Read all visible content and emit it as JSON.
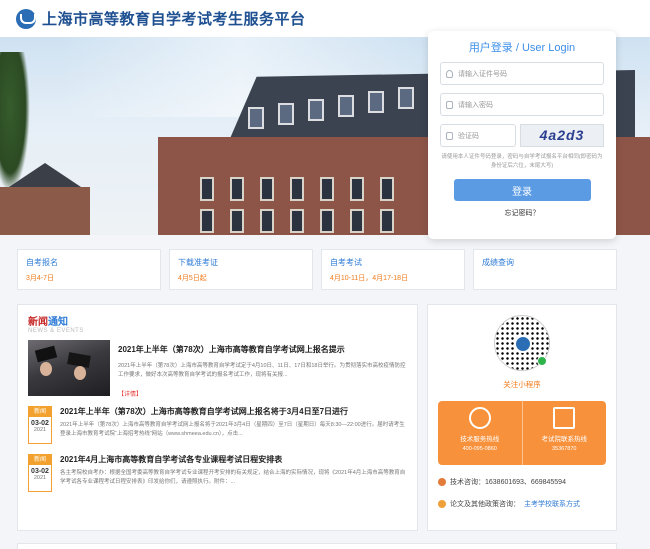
{
  "header": {
    "site_title": "上海市高等教育自学考试考生服务平台"
  },
  "login": {
    "title": "用户登录 / User Login",
    "id_placeholder": "请输入证件号码",
    "pwd_placeholder": "请输入密码",
    "captcha_placeholder": "验证码",
    "captcha_text": "4a2d3",
    "tip": "请使用本人证件号码登录，密码与自学考试报名平台相同(即密码为身份证后六位，末尾大写)",
    "submit": "登录",
    "forgot": "忘记密码？"
  },
  "quick": [
    {
      "title": "自考报名",
      "date": "3月4-7日"
    },
    {
      "title": "下载准考证",
      "date": "4月5日起"
    },
    {
      "title": "自考考试",
      "date": "4月10-11日，4月17-18日"
    },
    {
      "title": "成绩查询",
      "date": ""
    }
  ],
  "news": {
    "heading_red": "新闻",
    "heading_blue": "通知",
    "heading_en": "NEWS & EVENTS",
    "featured": {
      "title": "2021年上半年（第78次）上海市高等教育自学考试网上报名提示",
      "desc": "2021年上半年（第78次）上海市高等教育自学考试定于4月10日、11日、17日和18日举行。为贯彻落实市高校疫情防控工作要求，做好本次高等教育自学考试的报名考试工作，现将有关报...",
      "detail": "【详情】"
    },
    "items": [
      {
        "badge": "新闻",
        "md": "03-02",
        "year": "2021",
        "title": "2021年上半年（第78次）上海市高等教育自学考试网上报名将于3月4日至7日进行",
        "desc": "2021年上半年（第78次）上海市高等教育自学考试网上报名将于2021年3月4日（星期四）至7日（星期日）每天8:30—22:00进行。届时请考生登录上海市教育考试院“上海招考热线”网站（www.shmeea.edu.cn），点击..."
      },
      {
        "badge": "新闻",
        "md": "03-02",
        "year": "2021",
        "title": "2021年4月上海市高等教育自学考试各专业课程考试日程安排表",
        "desc": "各主考院校自考办：根据全国考委高等教育自学考试专业课程开考安排的有关规定，结合上海的实际情况，现将《2021年4月上海市高等教育自学考试各专业课程考试日程安排表》印发给你们，请遵照执行。附件：..."
      }
    ]
  },
  "side": {
    "mini_program": "关注小程序",
    "hotline1_label": "技术服务热线",
    "hotline1_num": "400-095-0860",
    "hotline2_label": "考试院联系热线",
    "hotline2_num": "35367870",
    "tech_consult": "技术咨询：1638601693、669845594",
    "policy_prefix": "论文及其他政策咨询：",
    "policy_link": "主考学校联系方式"
  }
}
